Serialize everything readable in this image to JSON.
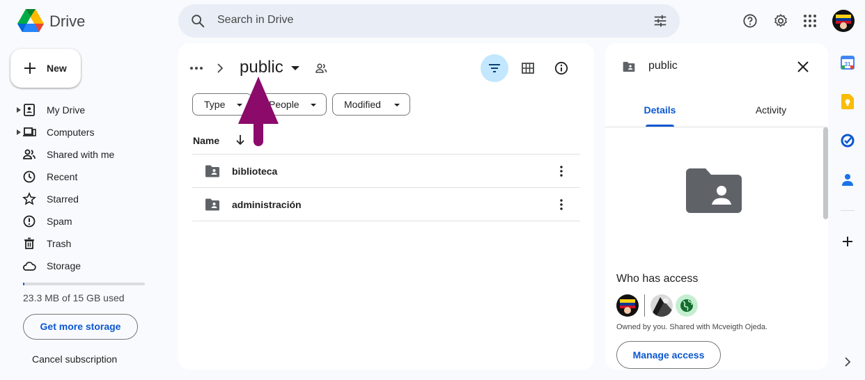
{
  "header": {
    "app_name": "Drive",
    "search_placeholder": "Search in Drive"
  },
  "new_button": {
    "label": "New"
  },
  "sidebar": {
    "items": [
      {
        "label": "My Drive",
        "icon": "my-drive-icon",
        "expandable": true
      },
      {
        "label": "Computers",
        "icon": "computer-icon",
        "expandable": true
      },
      {
        "label": "Shared with me",
        "icon": "people-icon",
        "expandable": false
      },
      {
        "label": "Recent",
        "icon": "clock-icon",
        "expandable": false
      },
      {
        "label": "Starred",
        "icon": "star-icon",
        "expandable": false
      },
      {
        "label": "Spam",
        "icon": "spam-icon",
        "expandable": false
      },
      {
        "label": "Trash",
        "icon": "trash-icon",
        "expandable": false
      },
      {
        "label": "Storage",
        "icon": "cloud-icon",
        "expandable": false
      }
    ],
    "storage_text": "23.3 MB of 15 GB used",
    "storage_fraction": 0.0016,
    "get_more_storage": "Get more storage",
    "cancel_subscription": "Cancel subscription"
  },
  "main": {
    "folder_title": "public",
    "filters": [
      {
        "label": "Type"
      },
      {
        "label": "People"
      },
      {
        "label": "Modified"
      }
    ],
    "column_name": "Name",
    "rows": [
      {
        "name": "biblioteca",
        "icon": "shared-folder-icon"
      },
      {
        "name": "administración",
        "icon": "shared-folder-icon"
      }
    ]
  },
  "details": {
    "title": "public",
    "tabs": [
      "Details",
      "Activity"
    ],
    "active_tab": "Details",
    "who_has_access": "Who has access",
    "owned_text": "Owned by you. Shared with Mcveigth Ojeda.",
    "manage_access": "Manage access"
  },
  "colors": {
    "accent": "#0b57d0",
    "annotation_arrow": "#8b0a6a",
    "filter_active_bg": "#c2e7ff",
    "background": "#f8fafd"
  },
  "right_rail": [
    "calendar-icon",
    "keep-icon",
    "tasks-icon",
    "contacts-icon",
    "add-icon"
  ]
}
